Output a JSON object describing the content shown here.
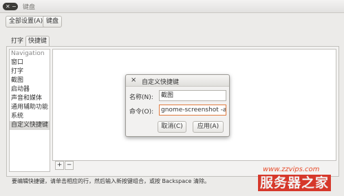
{
  "window": {
    "title": "键盘"
  },
  "breadcrumb": {
    "all_settings": "全部设置(A)",
    "current": "键盘"
  },
  "tabs": [
    {
      "label": "打字"
    },
    {
      "label": "快捷键"
    }
  ],
  "sidebar": {
    "items": [
      {
        "label": "Navigation"
      },
      {
        "label": "窗口"
      },
      {
        "label": "打字"
      },
      {
        "label": "截图"
      },
      {
        "label": "启动器"
      },
      {
        "label": "声音和媒体"
      },
      {
        "label": "通用辅助功能"
      },
      {
        "label": "系统"
      },
      {
        "label": "自定义快捷键"
      }
    ]
  },
  "toolbar": {
    "add": "+",
    "remove": "−"
  },
  "hint": "要编辑快捷键，请单击相应的行，然后输入新按键组合，或按 Backspace 清除。",
  "dialog": {
    "title": "自定义快捷键",
    "name_label": "名称(N):",
    "name_value": "截图",
    "command_label": "命令(O):",
    "command_value": "gnome-screenshot -a",
    "cancel": "取消(C)",
    "apply": "应用(A)"
  },
  "watermark": {
    "url": "www.zzvips.com",
    "brand": "服务器之家"
  },
  "colors": {
    "focus": "#e07a3e",
    "watermark": "#d6382b"
  }
}
